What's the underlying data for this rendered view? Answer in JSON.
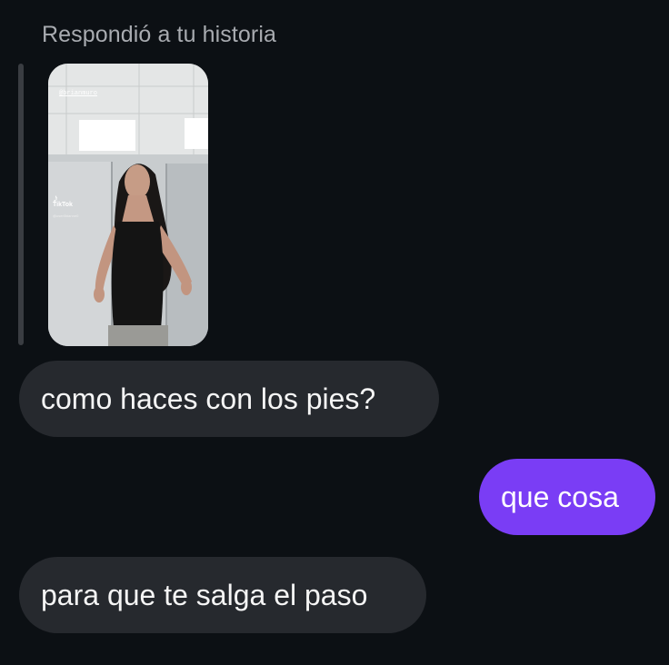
{
  "reply": {
    "label": "Respondió a tu historia"
  },
  "story": {
    "username_overlay": "@brianmuro",
    "tiktok_label": "TikTok",
    "tiktok_handle": "@user0bianne0"
  },
  "messages": [
    {
      "direction": "incoming",
      "text": "como haces con los pies?"
    },
    {
      "direction": "outgoing",
      "text": "que cosa"
    },
    {
      "direction": "incoming",
      "text": "para que te salga el paso"
    }
  ],
  "colors": {
    "background": "#0c1014",
    "incoming_bubble": "#26292e",
    "outgoing_bubble": "#7a3df5",
    "reply_label": "#a8abb0"
  }
}
